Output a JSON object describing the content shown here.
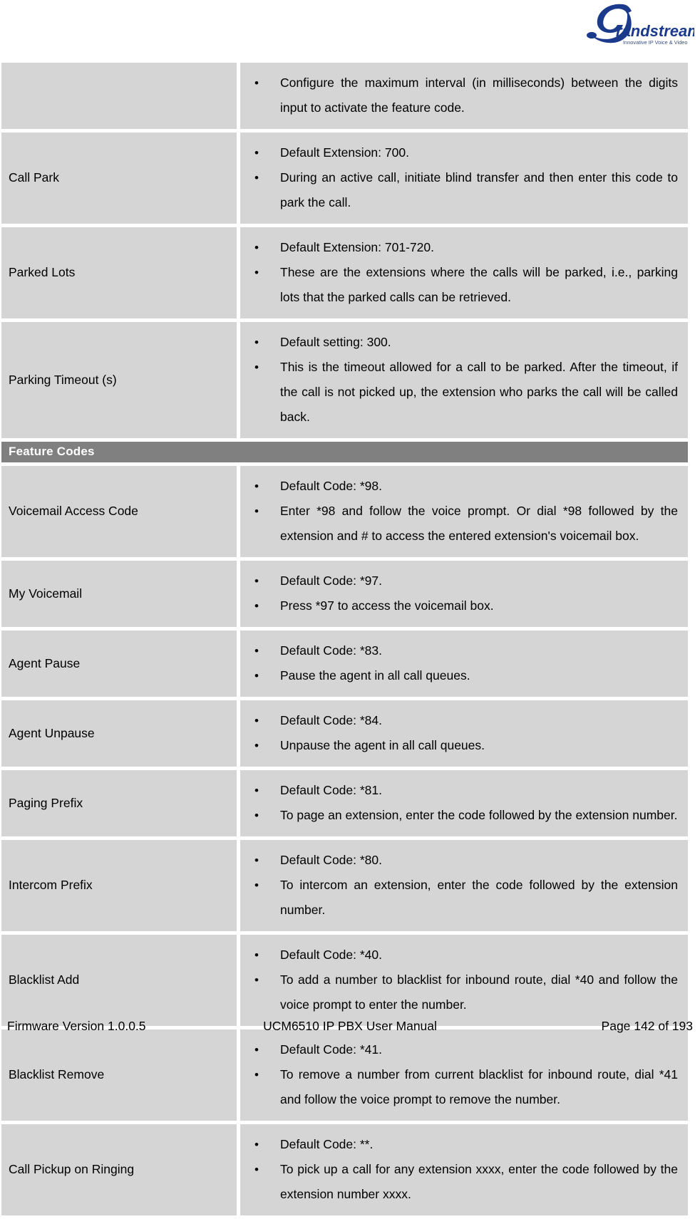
{
  "header": {
    "logo_name": "grandstream-logo",
    "logo_wordmark": "randstream",
    "logo_tagline": "Innovative IP Voice & Video",
    "logo_color": "#1b3a8c"
  },
  "colors": {
    "cell_background": "#d5d5d5",
    "section_banner_background": "#808080",
    "section_banner_text": "#ffffff",
    "page_background": "#ffffff"
  },
  "table": {
    "rows": [
      {
        "type": "data",
        "label": "",
        "bullets": [
          "Configure the maximum interval (in milliseconds) between the digits input to activate the feature code."
        ]
      },
      {
        "type": "data",
        "label": "Call Park",
        "bullets": [
          "Default Extension: 700.",
          "During an active call, initiate blind transfer and then enter this code to park the call."
        ]
      },
      {
        "type": "data",
        "label": "Parked Lots",
        "bullets": [
          "Default Extension: 701-720.",
          "These are the extensions where the calls will be parked, i.e., parking lots that the parked calls can be retrieved."
        ]
      },
      {
        "type": "data",
        "label": "Parking Timeout (s)",
        "bullets": [
          "Default setting: 300.",
          "This is the timeout allowed for a call to be parked. After the timeout, if the call is not picked up, the extension who parks the call will be called back."
        ]
      },
      {
        "type": "section",
        "label": "Feature Codes"
      },
      {
        "type": "data",
        "label": "Voicemail Access Code",
        "bullets": [
          "Default Code: *98.",
          "Enter *98 and follow the voice prompt. Or dial *98 followed by the extension and # to access the entered extension's voicemail box."
        ]
      },
      {
        "type": "data",
        "label": "My Voicemail",
        "bullets": [
          "Default Code: *97.",
          "Press *97 to access the voicemail box."
        ]
      },
      {
        "type": "data",
        "label": "Agent Pause",
        "bullets": [
          "Default Code: *83.",
          "Pause the agent in all call queues."
        ]
      },
      {
        "type": "data",
        "label": "Agent Unpause",
        "bullets": [
          "Default Code: *84.",
          "Unpause the agent in all call queues."
        ]
      },
      {
        "type": "data",
        "label": "Paging Prefix",
        "bullets": [
          "Default Code: *81.",
          "To page an extension, enter the code followed by the extension number."
        ]
      },
      {
        "type": "data",
        "label": "Intercom Prefix",
        "bullets": [
          "Default Code: *80.",
          "To intercom an extension, enter the code followed by the extension number."
        ]
      },
      {
        "type": "data",
        "label": "Blacklist Add",
        "bullets": [
          "Default Code: *40.",
          "To add a number to blacklist for inbound route, dial *40 and follow the voice prompt to enter the number."
        ]
      },
      {
        "type": "data",
        "label": "Blacklist Remove",
        "bullets": [
          "Default Code: *41.",
          "To remove a number from current blacklist for inbound route, dial *41 and follow the voice prompt to remove the number."
        ]
      },
      {
        "type": "data",
        "label": "Call Pickup on Ringing",
        "bullets": [
          "Default Code: **.",
          "To pick up a call for any extension xxxx, enter the code followed by the extension number xxxx."
        ]
      }
    ]
  },
  "footer": {
    "left": "Firmware Version 1.0.0.5",
    "center": "UCM6510 IP PBX User Manual",
    "right": "Page 142 of 193"
  }
}
